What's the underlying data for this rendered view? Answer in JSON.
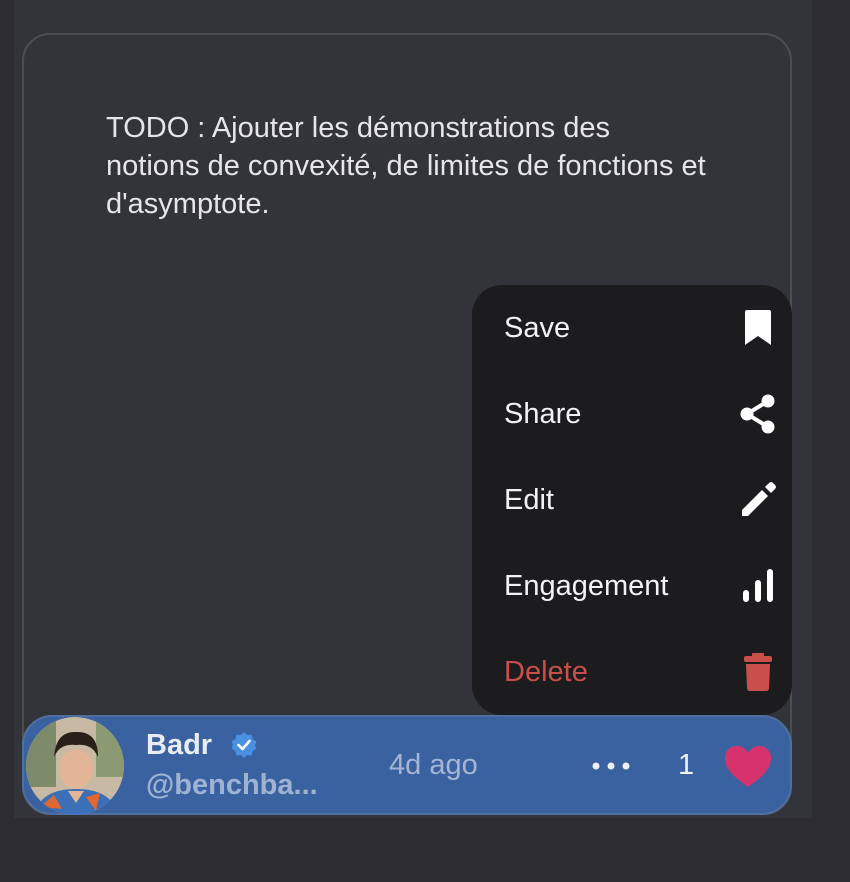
{
  "post": {
    "text": "TODO : Ajouter les démonstrations des notions de convexité, de limites de fonctions et d'asymptote."
  },
  "menu": {
    "items": [
      {
        "label": "Save",
        "icon": "bookmark-icon"
      },
      {
        "label": "Share",
        "icon": "share-icon"
      },
      {
        "label": "Edit",
        "icon": "pencil-icon"
      },
      {
        "label": "Engagement",
        "icon": "bar-chart-icon"
      },
      {
        "label": "Delete",
        "icon": "trash-icon"
      }
    ]
  },
  "author": {
    "name": "Badr",
    "handle": "@benchba...",
    "verified": true
  },
  "meta": {
    "time": "4d ago",
    "likes": "1"
  },
  "colors": {
    "accent": "#3a62a0",
    "danger": "#c9504a",
    "heart": "#d6336c",
    "verified": "#4a90e2"
  }
}
